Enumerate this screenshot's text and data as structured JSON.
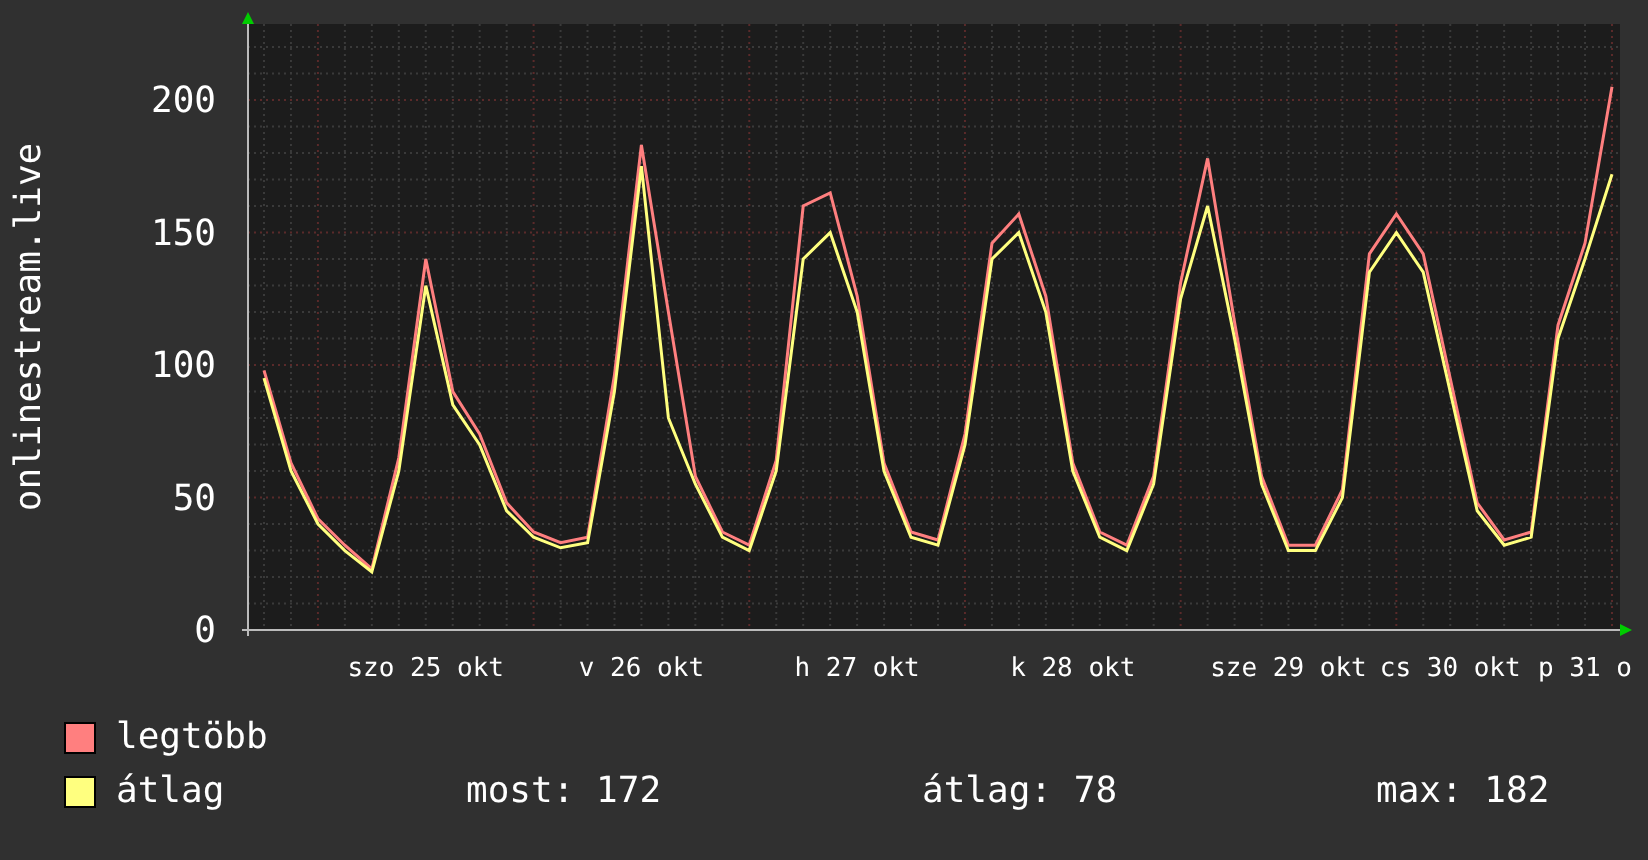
{
  "chart_data": {
    "type": "line",
    "ylabel": "onlinestream.live",
    "series": [
      {
        "name": "legtöbb",
        "color": "#ff7f7f",
        "values": [
          98,
          63,
          42,
          32,
          23,
          65,
          140,
          90,
          74,
          48,
          37,
          33,
          35,
          96,
          183,
          120,
          58,
          37,
          32,
          64,
          160,
          165,
          126,
          63,
          37,
          34,
          74,
          146,
          157,
          126,
          63,
          37,
          32,
          58,
          131,
          178,
          116,
          58,
          32,
          32,
          53,
          142,
          157,
          142,
          95,
          48,
          34,
          37,
          115,
          146,
          205
        ]
      },
      {
        "name": "átlag",
        "color": "#ffff7f",
        "values": [
          95,
          60,
          40,
          30,
          22,
          60,
          130,
          85,
          70,
          45,
          35,
          31,
          33,
          90,
          175,
          80,
          55,
          35,
          30,
          60,
          140,
          150,
          120,
          60,
          35,
          32,
          70,
          140,
          150,
          120,
          60,
          35,
          30,
          55,
          125,
          160,
          110,
          55,
          30,
          30,
          50,
          135,
          150,
          135,
          90,
          45,
          32,
          35,
          110,
          140,
          172
        ]
      }
    ],
    "categories": [
      null,
      null,
      null,
      null,
      null,
      null,
      "szo 25 okt",
      null,
      null,
      null,
      null,
      null,
      null,
      null,
      "v 26 okt",
      null,
      null,
      null,
      null,
      null,
      null,
      null,
      "h 27 okt",
      null,
      null,
      null,
      null,
      null,
      null,
      null,
      "k 28 okt",
      null,
      null,
      null,
      null,
      null,
      null,
      null,
      "sze 29 okt",
      null,
      null,
      null,
      null,
      null,
      "cs 30 okt",
      null,
      null,
      null,
      null,
      "p 31 o",
      null
    ],
    "ylim": [
      0,
      228.7
    ],
    "grid": true,
    "yticks": [
      0,
      50,
      100,
      150,
      200
    ]
  },
  "legend_stats": [
    "most: 172",
    "átlag: 78",
    "max: 182"
  ]
}
